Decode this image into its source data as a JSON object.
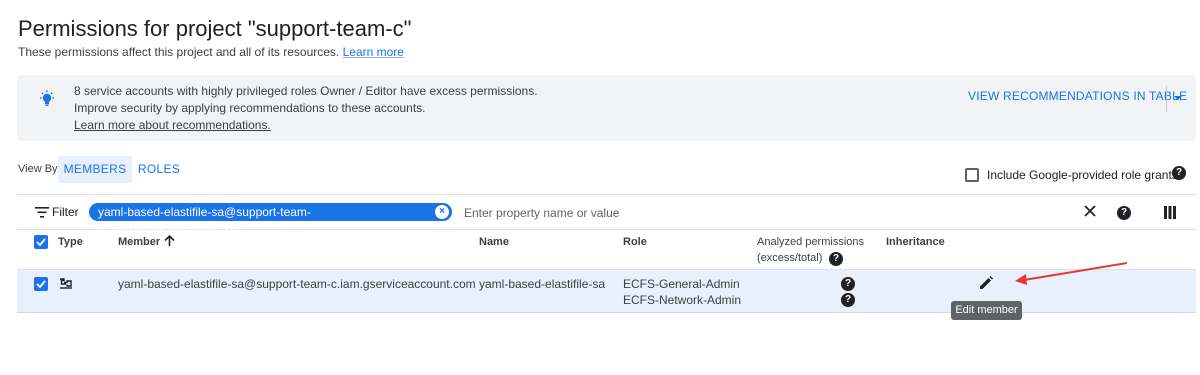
{
  "header": {
    "title": "Permissions for project \"support-team-c\"",
    "subtitle": "These permissions affect this project and all of its resources.",
    "learn_more": "Learn more"
  },
  "banner": {
    "line1": "8 service accounts with highly privileged roles Owner / Editor have excess permissions.",
    "line2": "Improve security by applying recommendations to these accounts.",
    "learn_link": "Learn more about recommendations.",
    "button": "VIEW RECOMMENDATIONS IN TABLE",
    "icon": "lightbulb-icon"
  },
  "view": {
    "label": "View By:",
    "tabs": [
      "MEMBERS",
      "ROLES"
    ],
    "selected": "MEMBERS"
  },
  "include": {
    "label": "Include Google-provided role grants",
    "checked": false
  },
  "filter": {
    "label": "Filter",
    "chip": "yaml-based-elastifile-sa@support-team-c.iam.gserviceaccount.com",
    "placeholder": "Enter property name or value"
  },
  "table": {
    "columns": {
      "type": "Type",
      "member": "Member",
      "name": "Name",
      "role": "Role",
      "analyzed1": "Analyzed permissions",
      "analyzed2": "(excess/total)",
      "inheritance": "Inheritance"
    },
    "rows": [
      {
        "checked": true,
        "type_icon": "service-account-icon",
        "member": "yaml-based-elastifile-sa@support-team-c.iam.gserviceaccount.com",
        "name": "yaml-based-elastifile-sa",
        "roles": [
          "ECFS-General-Admin",
          "ECFS-Network-Admin"
        ]
      }
    ]
  },
  "tooltip": "Edit member",
  "colors": {
    "accent": "#1a73e8",
    "annotation_arrow": "#e53935",
    "banner_bg": "#f1f3f4",
    "selected_row": "#e8f0fe"
  }
}
